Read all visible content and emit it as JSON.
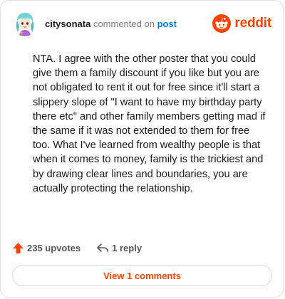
{
  "header": {
    "username": "citysonata",
    "action_text": "commented on",
    "post_link": "post",
    "brand_name": "reddit"
  },
  "comment": {
    "body": "NTA. I agree with the other poster that you could give them a family discount if you like but you are not obligated to rent it out for free since it'll start a slippery slope of \"I want to have my birthday party there etc\" and other family members getting mad if the same if it was not extended to them for free too. What I've learned from wealthy people is that when it comes to money, family is the trickiest and by drawing clear lines and boundaries, you are actually protecting the relationship."
  },
  "actions": {
    "upvotes": "235 upvotes",
    "replies": "1 reply",
    "upvote_icon": "upvote-arrow-icon",
    "reply_icon": "reply-arrow-icon"
  },
  "footer": {
    "view_comments_label": "View 1 comments"
  },
  "colors": {
    "brand": "#ff4500",
    "link": "#0079d3",
    "text": "#1a1a1b",
    "muted": "#7c7c7c"
  }
}
